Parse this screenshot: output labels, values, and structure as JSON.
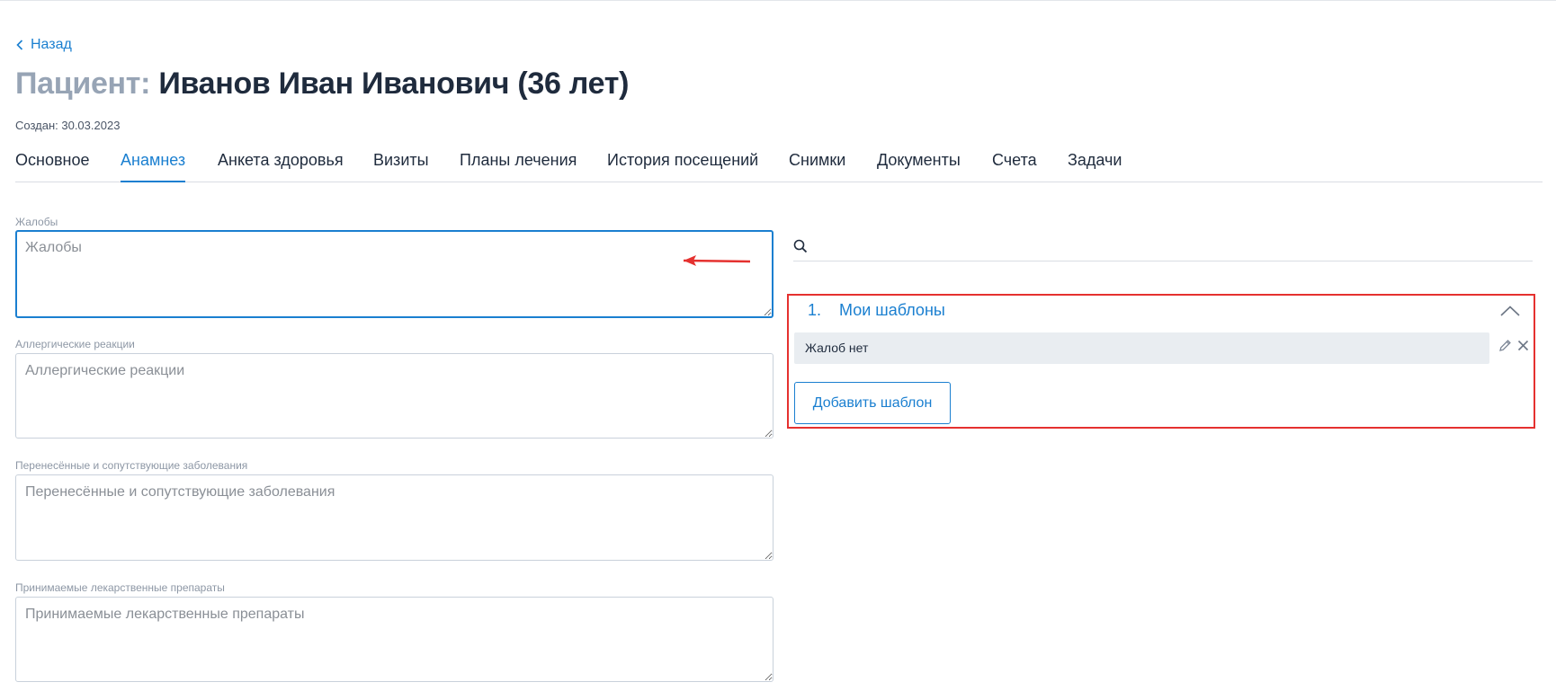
{
  "nav": {
    "back_label": "Назад"
  },
  "patient": {
    "title_label": "Пациент:",
    "title_name": "Иванов Иван Иванович (36 лет)",
    "created": "Создан: 30.03.2023"
  },
  "tabs": [
    {
      "label": "Основное"
    },
    {
      "label": "Анамнез"
    },
    {
      "label": "Анкета здоровья"
    },
    {
      "label": "Визиты"
    },
    {
      "label": "Планы лечения"
    },
    {
      "label": "История посещений"
    },
    {
      "label": "Снимки"
    },
    {
      "label": "Документы"
    },
    {
      "label": "Счета"
    },
    {
      "label": "Задачи"
    }
  ],
  "active_tab": "Анамнез",
  "fields": [
    {
      "label": "Жалобы",
      "placeholder": "Жалобы",
      "value": ""
    },
    {
      "label": "Аллергические реакции",
      "placeholder": "Аллергические реакции",
      "value": ""
    },
    {
      "label": "Перенесённые и сопутствующие заболевания",
      "placeholder": "Перенесённые и сопутствующие заболевания",
      "value": ""
    },
    {
      "label": "Принимаемые лекарственные препараты",
      "placeholder": "Принимаемые лекарственные препараты",
      "value": ""
    }
  ],
  "templates": {
    "search_placeholder": "",
    "group_number": "1.",
    "group_title": "Мои шаблоны",
    "items": [
      {
        "label": "Жалоб нет"
      }
    ],
    "add_label": "Добавить шаблон"
  },
  "colors": {
    "accent": "#1a7fd0",
    "title_muted": "#97a4b5",
    "annotation_red": "#e5312f",
    "item_bg": "#e9edf1"
  },
  "icons": {
    "back": "chevron-left-icon",
    "search": "search-icon",
    "collapse": "chevron-up-icon",
    "edit": "pencil-icon",
    "delete": "close-icon",
    "annotation": "arrow-left-icon"
  }
}
